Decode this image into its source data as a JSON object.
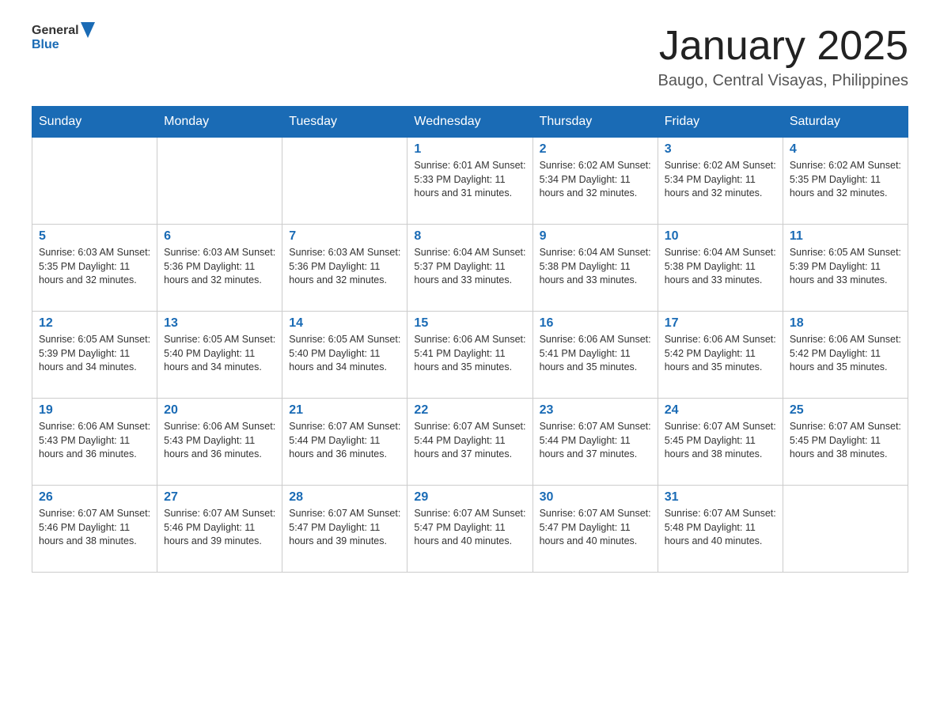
{
  "header": {
    "logo_general": "General",
    "logo_blue": "Blue",
    "title": "January 2025",
    "subtitle": "Baugo, Central Visayas, Philippines"
  },
  "weekdays": [
    "Sunday",
    "Monday",
    "Tuesday",
    "Wednesday",
    "Thursday",
    "Friday",
    "Saturday"
  ],
  "weeks": [
    [
      {
        "day": "",
        "info": ""
      },
      {
        "day": "",
        "info": ""
      },
      {
        "day": "",
        "info": ""
      },
      {
        "day": "1",
        "info": "Sunrise: 6:01 AM\nSunset: 5:33 PM\nDaylight: 11 hours and 31 minutes."
      },
      {
        "day": "2",
        "info": "Sunrise: 6:02 AM\nSunset: 5:34 PM\nDaylight: 11 hours and 32 minutes."
      },
      {
        "day": "3",
        "info": "Sunrise: 6:02 AM\nSunset: 5:34 PM\nDaylight: 11 hours and 32 minutes."
      },
      {
        "day": "4",
        "info": "Sunrise: 6:02 AM\nSunset: 5:35 PM\nDaylight: 11 hours and 32 minutes."
      }
    ],
    [
      {
        "day": "5",
        "info": "Sunrise: 6:03 AM\nSunset: 5:35 PM\nDaylight: 11 hours and 32 minutes."
      },
      {
        "day": "6",
        "info": "Sunrise: 6:03 AM\nSunset: 5:36 PM\nDaylight: 11 hours and 32 minutes."
      },
      {
        "day": "7",
        "info": "Sunrise: 6:03 AM\nSunset: 5:36 PM\nDaylight: 11 hours and 32 minutes."
      },
      {
        "day": "8",
        "info": "Sunrise: 6:04 AM\nSunset: 5:37 PM\nDaylight: 11 hours and 33 minutes."
      },
      {
        "day": "9",
        "info": "Sunrise: 6:04 AM\nSunset: 5:38 PM\nDaylight: 11 hours and 33 minutes."
      },
      {
        "day": "10",
        "info": "Sunrise: 6:04 AM\nSunset: 5:38 PM\nDaylight: 11 hours and 33 minutes."
      },
      {
        "day": "11",
        "info": "Sunrise: 6:05 AM\nSunset: 5:39 PM\nDaylight: 11 hours and 33 minutes."
      }
    ],
    [
      {
        "day": "12",
        "info": "Sunrise: 6:05 AM\nSunset: 5:39 PM\nDaylight: 11 hours and 34 minutes."
      },
      {
        "day": "13",
        "info": "Sunrise: 6:05 AM\nSunset: 5:40 PM\nDaylight: 11 hours and 34 minutes."
      },
      {
        "day": "14",
        "info": "Sunrise: 6:05 AM\nSunset: 5:40 PM\nDaylight: 11 hours and 34 minutes."
      },
      {
        "day": "15",
        "info": "Sunrise: 6:06 AM\nSunset: 5:41 PM\nDaylight: 11 hours and 35 minutes."
      },
      {
        "day": "16",
        "info": "Sunrise: 6:06 AM\nSunset: 5:41 PM\nDaylight: 11 hours and 35 minutes."
      },
      {
        "day": "17",
        "info": "Sunrise: 6:06 AM\nSunset: 5:42 PM\nDaylight: 11 hours and 35 minutes."
      },
      {
        "day": "18",
        "info": "Sunrise: 6:06 AM\nSunset: 5:42 PM\nDaylight: 11 hours and 35 minutes."
      }
    ],
    [
      {
        "day": "19",
        "info": "Sunrise: 6:06 AM\nSunset: 5:43 PM\nDaylight: 11 hours and 36 minutes."
      },
      {
        "day": "20",
        "info": "Sunrise: 6:06 AM\nSunset: 5:43 PM\nDaylight: 11 hours and 36 minutes."
      },
      {
        "day": "21",
        "info": "Sunrise: 6:07 AM\nSunset: 5:44 PM\nDaylight: 11 hours and 36 minutes."
      },
      {
        "day": "22",
        "info": "Sunrise: 6:07 AM\nSunset: 5:44 PM\nDaylight: 11 hours and 37 minutes."
      },
      {
        "day": "23",
        "info": "Sunrise: 6:07 AM\nSunset: 5:44 PM\nDaylight: 11 hours and 37 minutes."
      },
      {
        "day": "24",
        "info": "Sunrise: 6:07 AM\nSunset: 5:45 PM\nDaylight: 11 hours and 38 minutes."
      },
      {
        "day": "25",
        "info": "Sunrise: 6:07 AM\nSunset: 5:45 PM\nDaylight: 11 hours and 38 minutes."
      }
    ],
    [
      {
        "day": "26",
        "info": "Sunrise: 6:07 AM\nSunset: 5:46 PM\nDaylight: 11 hours and 38 minutes."
      },
      {
        "day": "27",
        "info": "Sunrise: 6:07 AM\nSunset: 5:46 PM\nDaylight: 11 hours and 39 minutes."
      },
      {
        "day": "28",
        "info": "Sunrise: 6:07 AM\nSunset: 5:47 PM\nDaylight: 11 hours and 39 minutes."
      },
      {
        "day": "29",
        "info": "Sunrise: 6:07 AM\nSunset: 5:47 PM\nDaylight: 11 hours and 40 minutes."
      },
      {
        "day": "30",
        "info": "Sunrise: 6:07 AM\nSunset: 5:47 PM\nDaylight: 11 hours and 40 minutes."
      },
      {
        "day": "31",
        "info": "Sunrise: 6:07 AM\nSunset: 5:48 PM\nDaylight: 11 hours and 40 minutes."
      },
      {
        "day": "",
        "info": ""
      }
    ]
  ]
}
